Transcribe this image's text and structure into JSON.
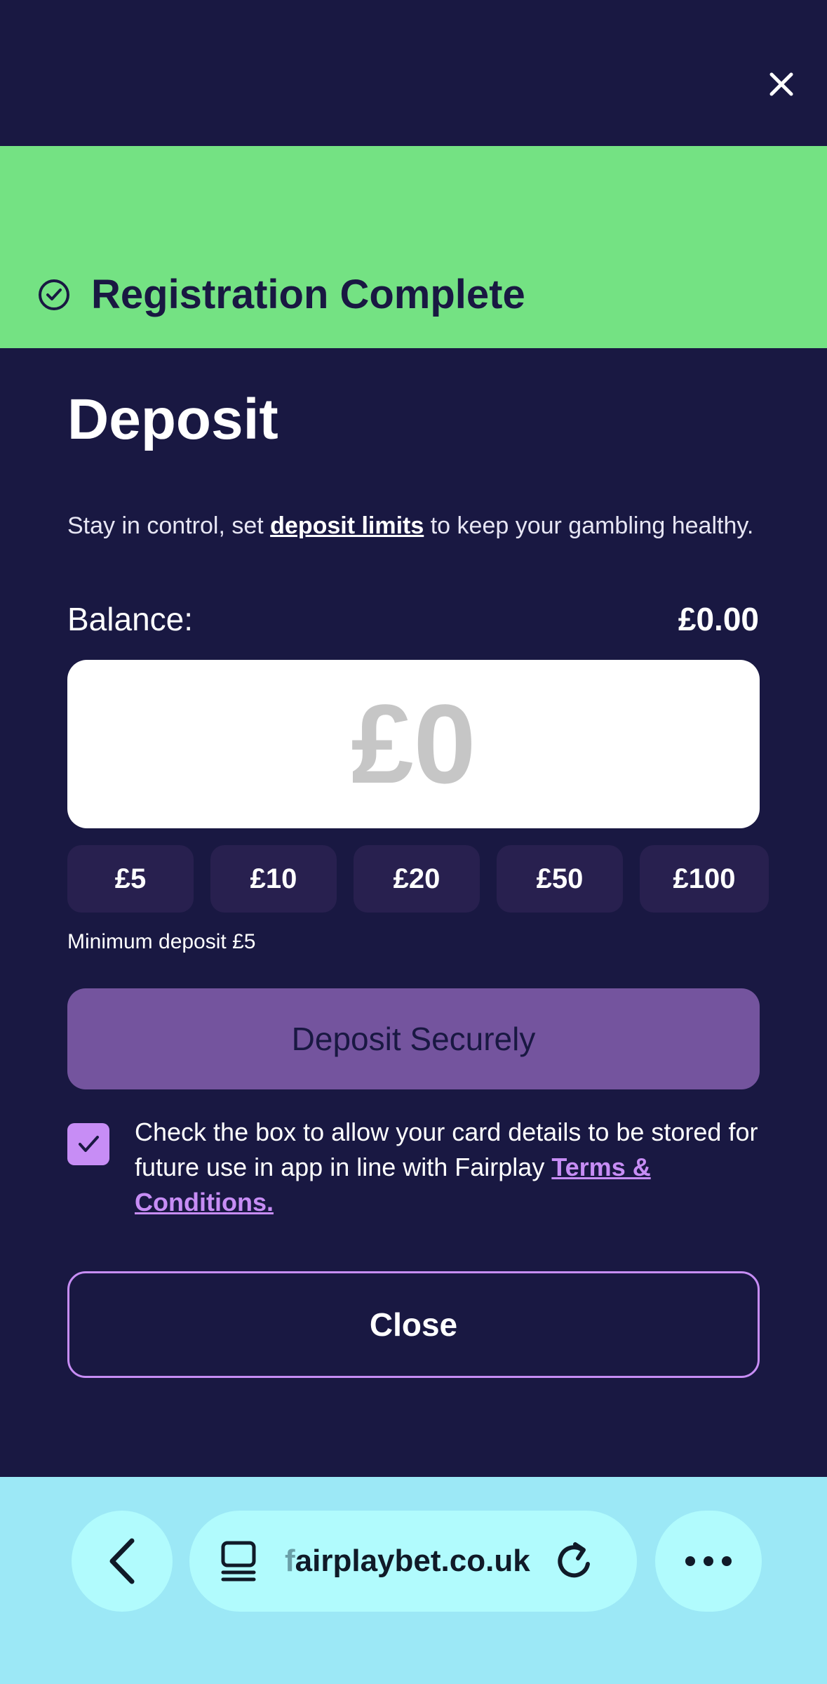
{
  "header": {
    "close_icon": "close-icon"
  },
  "banner": {
    "title": "Registration Complete",
    "icon": "check-circle-icon",
    "color": "#74e283"
  },
  "deposit": {
    "heading": "Deposit",
    "info_prefix": "Stay in control, set ",
    "info_link": "deposit limits",
    "info_suffix": " to keep your gambling healthy.",
    "balance_label": "Balance:",
    "balance_value": "£0.00",
    "amount_placeholder": "£0",
    "quick_amounts": [
      "£5",
      "£10",
      "£20",
      "£50",
      "£100"
    ],
    "minimum_text": "Minimum deposit £5",
    "deposit_button": "Deposit Securely",
    "store_card_checked": true,
    "store_card_text": "Check the box to allow your card details to be stored for future use in app in line with Fairplay ",
    "terms_link": "Terms & Conditions.",
    "close_button": "Close"
  },
  "browser": {
    "url_first_letter": "f",
    "url_rest": "airplaybet.co.uk",
    "icons": [
      "back-arrow-icon",
      "tabs-icon",
      "reload-icon",
      "more-icon"
    ]
  },
  "colors": {
    "background": "#191842",
    "accent": "#c78df5",
    "deposit_button": "#74549e",
    "browser_bar": "#9ce8f6"
  }
}
